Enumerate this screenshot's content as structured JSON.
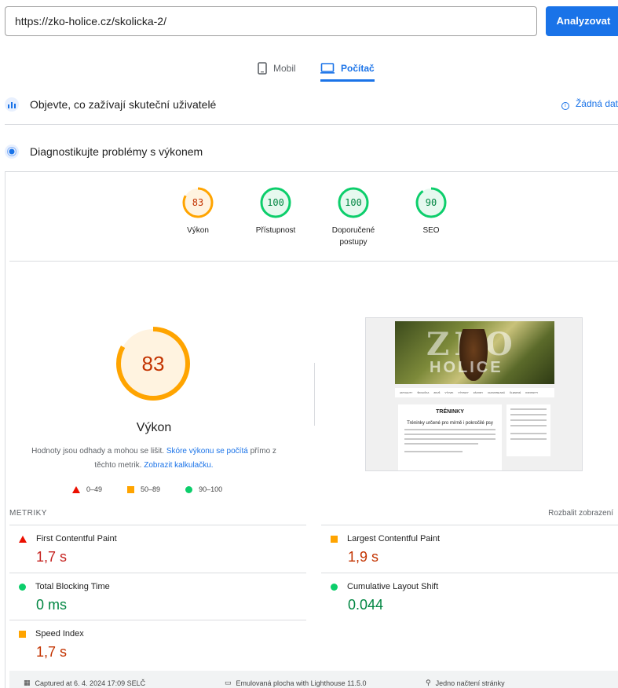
{
  "search": {
    "url": "https://zko-holice.cz/skolicka-2/",
    "analyze_label": "Analyzovat"
  },
  "tabs": {
    "mobile": "Mobil",
    "desktop": "Počítač"
  },
  "field_section": {
    "title": "Objevte, co zažívají skuteční uživatelé",
    "no_data": "Žádná dat"
  },
  "lab_section": {
    "title": "Diagnostikujte problémy s výkonem"
  },
  "scores": [
    {
      "value": "83",
      "label": "Výkon",
      "score": 83,
      "color": "#ffa400",
      "text_color": "#c33300"
    },
    {
      "value": "100",
      "label": "Přístupnost",
      "score": 100,
      "color": "#0cce6b",
      "text_color": "#018642"
    },
    {
      "value": "100",
      "label": "Doporučené postupy",
      "score": 100,
      "color": "#0cce6b",
      "text_color": "#018642"
    },
    {
      "value": "90",
      "label": "SEO",
      "score": 90,
      "color": "#0cce6b",
      "text_color": "#018642"
    }
  ],
  "performance": {
    "score": "83",
    "score_fraction": 0.83,
    "title": "Výkon",
    "note_prefix": "Hodnoty jsou odhady a mohou se lišit.",
    "note_link1": "Skóre výkonu se počítá",
    "note_mid": "přímo z těchto metrik.",
    "note_link2": "Zobrazit kalkulačku."
  },
  "legend": {
    "fail": "0–49",
    "average": "50–89",
    "pass": "90–100"
  },
  "screenshot": {
    "logo": "ZKO",
    "logo2": "HOLICE",
    "nav": [
      "AKTUALITY",
      "ŠKOLIČKA",
      "ZKUŠ",
      "VÝCVIK",
      "VÝSTAVY",
      "ZÁVODY",
      "CHOVATELSKÁ",
      "ČLENOVÉ",
      "KONTAKTY"
    ],
    "heading": "TRÉNINKY",
    "sub": "Tréninky určené pro mírně i pokročilé psy"
  },
  "metrics": {
    "header": "METRIKY",
    "expand": "Rozbalit zobrazení",
    "items": [
      {
        "name": "First Contentful Paint",
        "value": "1,7 s",
        "status": "fail"
      },
      {
        "name": "Largest Contentful Paint",
        "value": "1,9 s",
        "status": "average"
      },
      {
        "name": "Total Blocking Time",
        "value": "0 ms",
        "status": "pass"
      },
      {
        "name": "Cumulative Layout Shift",
        "value": "0.044",
        "status": "pass"
      },
      {
        "name": "Speed Index",
        "value": "1,7 s",
        "status": "average"
      }
    ]
  },
  "footer": {
    "captured": "Captured at 6. 4. 2024 17:09 SELČ",
    "emulated": "Emulovaná plocha with Lighthouse 11.5.0",
    "single": "Jedno načtení stránky"
  }
}
